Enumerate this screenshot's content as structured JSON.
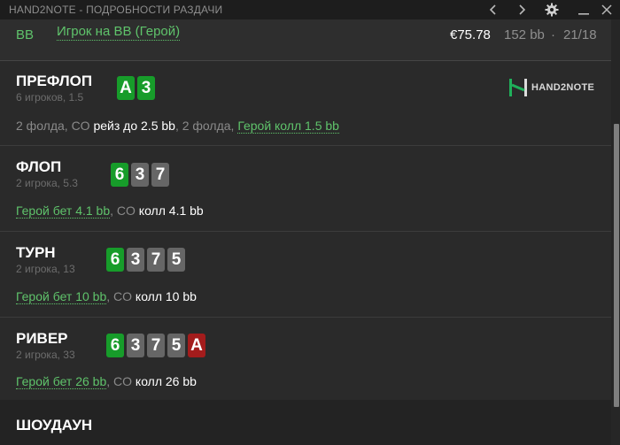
{
  "window": {
    "title": "HAND2NOTE - ПОДРОБНОСТИ РАЗДАЧИ",
    "icons": [
      "chevron-left-icon",
      "chevron-right-icon",
      "gear-icon",
      "minimize-icon",
      "close-icon"
    ]
  },
  "player": {
    "position": "BB",
    "name": "Игрок на BB (Герой)",
    "stack": "€75.78",
    "stack_bb": "152 bb",
    "separator": "·",
    "seat": "21/18"
  },
  "logo": {
    "text": "HAND2NOTE"
  },
  "streets": {
    "preflop": {
      "name": "ПРЕФЛОП",
      "subtitle": "6 игроков, 1.5",
      "cards": [
        "A",
        "3"
      ],
      "actions": {
        "a1": "2 фолда, CO ",
        "a2": "рейз до 2.5 bb",
        "a3": ", 2 фолда, ",
        "a4": "Герой колл 1.5 bb"
      }
    },
    "flop": {
      "name": "ФЛОП",
      "subtitle": "2 игрока, 5.3",
      "cards": [
        "6",
        "3",
        "7"
      ],
      "actions": {
        "a1": "Герой бет 4.1 bb",
        "a2": ", CO ",
        "a3": "колл 4.1 bb"
      }
    },
    "turn": {
      "name": "ТУРН",
      "subtitle": "2 игрока, 13",
      "cards": [
        "6",
        "3",
        "7",
        "5"
      ],
      "actions": {
        "a1": "Герой бет 10 bb",
        "a2": ", CO ",
        "a3": "колл 10 bb"
      }
    },
    "river": {
      "name": "РИВЕР",
      "subtitle": "2 игрока, 33",
      "cards": [
        "6",
        "3",
        "7",
        "5",
        "A"
      ],
      "actions": {
        "a1": "Герой бет 26 bb",
        "a2": ", CO ",
        "a3": "колл 26 bb"
      }
    },
    "showdown": {
      "name": "ШОУДАУН"
    }
  },
  "colors": {
    "hero_green": "#5fc36b",
    "card_green": "#179c2a",
    "card_gray": "#666666",
    "card_red": "#a31c1c",
    "background": "#2a2a2a"
  }
}
